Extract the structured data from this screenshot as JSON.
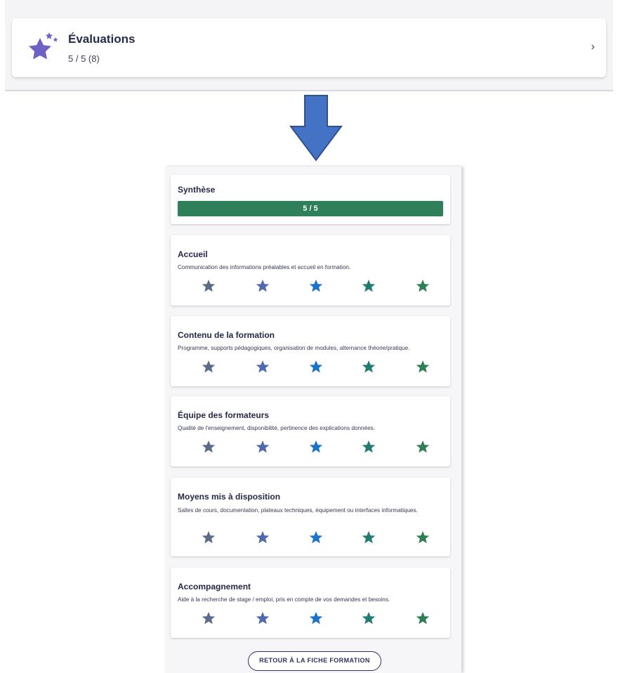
{
  "summary_card": {
    "title": "Évaluations",
    "subtitle": "5 / 5 (8)",
    "icon": "stars-icon",
    "icon_color": "#6e61c6",
    "chevron": "›"
  },
  "synthese": {
    "title": "Synthèse",
    "score_label": "5 / 5",
    "score_fraction": 1.0,
    "bar_color": "#2f7f5a"
  },
  "star_colors": [
    "#5c6b8a",
    "#4f6ab1",
    "#1a73c8",
    "#1f7c6f",
    "#2f7f55"
  ],
  "criteria": [
    {
      "title": "Accueil",
      "description": "Communication des informations préalables et accueil en formation.",
      "rating": 5
    },
    {
      "title": "Contenu de la formation",
      "description": "Programme, supports pédagogiques, organisation de modules, alternance théorie/pratique.",
      "rating": 5
    },
    {
      "title": "Équipe des formateurs",
      "description": "Qualité de l'enseignement, disponibilité, pertinence des explications données.",
      "rating": 5
    },
    {
      "title": "Moyens mis à disposition",
      "description": "Salles de cours, documentation, plateaux techniques, équipement ou interfaces informatiques.",
      "rating": 5
    },
    {
      "title": "Accompagnement",
      "description": "Aide à la recherche de stage / emploi, pris en compte de vos demandes et besoins.",
      "rating": 5
    }
  ],
  "back_button": {
    "label": "RETOUR À LA FICHE FORMATION"
  },
  "arrow": {
    "icon": "arrow-down-icon",
    "color": "#4472c4"
  }
}
